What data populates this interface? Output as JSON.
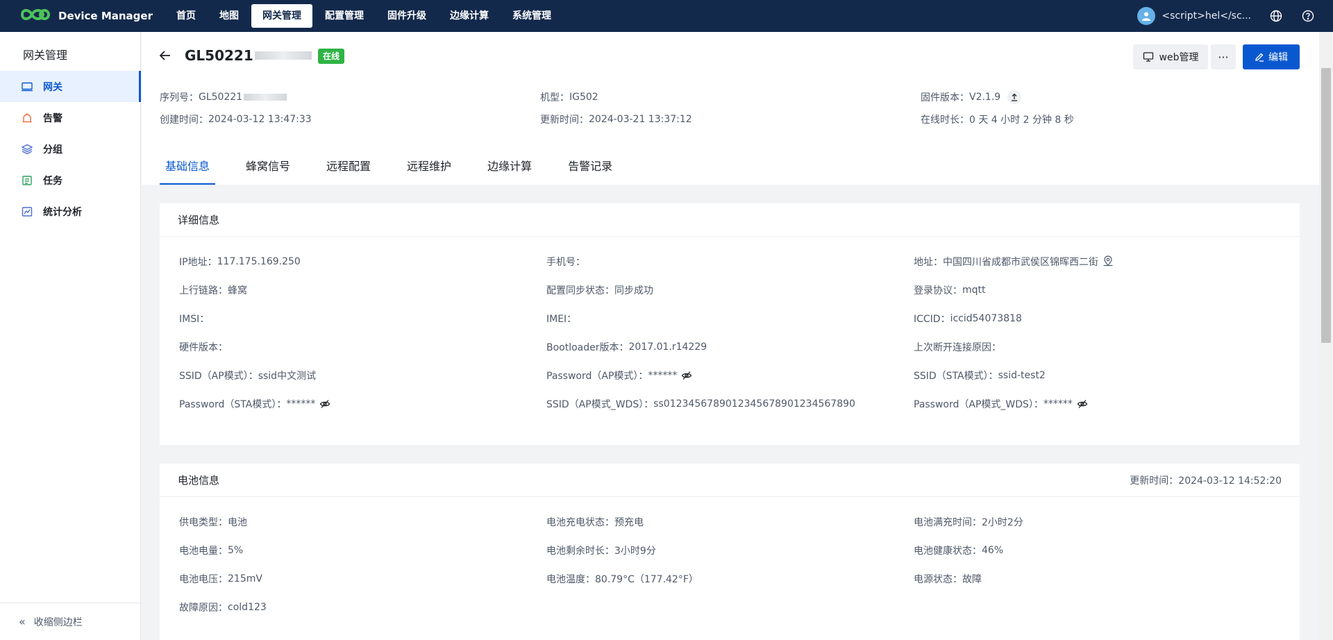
{
  "app": {
    "brand": "Device Manager"
  },
  "nav": [
    {
      "label": "首页",
      "active": false
    },
    {
      "label": "地图",
      "active": false
    },
    {
      "label": "网关管理",
      "active": true
    },
    {
      "label": "配置管理",
      "active": false
    },
    {
      "label": "固件升级",
      "active": false
    },
    {
      "label": "边缘计算",
      "active": false
    },
    {
      "label": "系统管理",
      "active": false
    }
  ],
  "user": {
    "name": "<script>hel</sc..."
  },
  "sidebar": {
    "title": "网关管理",
    "items": [
      {
        "label": "网关",
        "icon": "gateway-icon",
        "active": true
      },
      {
        "label": "告警",
        "icon": "alarm-icon",
        "active": false
      },
      {
        "label": "分组",
        "icon": "layers-icon",
        "active": false
      },
      {
        "label": "任务",
        "icon": "task-icon",
        "active": false
      },
      {
        "label": "统计分析",
        "icon": "stats-icon",
        "active": false
      }
    ],
    "collapse_label": "收缩侧边栏"
  },
  "device": {
    "title": "GL50221",
    "status": "在线",
    "status_color": "#2fb344",
    "serial_label": "序列号：",
    "serial": "GL50221",
    "model_label": "机型：",
    "model": "IG502",
    "firmware_label": "固件版本：",
    "firmware": "V2.1.9",
    "created_label": "创建时间：",
    "created": "2024-03-12 13:47:33",
    "updated_label": "更新时间：",
    "updated": "2024-03-21 13:37:12",
    "uptime_label": "在线时长：",
    "uptime": "0 天 4 小时 2 分钟 8 秒"
  },
  "actions": {
    "web": "web管理",
    "more": "···",
    "edit": "编辑"
  },
  "tabs": [
    {
      "label": "基础信息",
      "active": true
    },
    {
      "label": "蜂窝信号",
      "active": false
    },
    {
      "label": "远程配置",
      "active": false
    },
    {
      "label": "远程维护",
      "active": false
    },
    {
      "label": "边缘计算",
      "active": false
    },
    {
      "label": "告警记录",
      "active": false
    }
  ],
  "detail": {
    "title": "详细信息",
    "fields": [
      {
        "label": "IP地址：",
        "value": "117.175.169.250"
      },
      {
        "label": "手机号：",
        "value": ""
      },
      {
        "label": "地址：",
        "value": "中国四川省成都市武侯区锦晖西二街"
      },
      {
        "label": "上行链路：",
        "value": "蜂窝"
      },
      {
        "label": "配置同步状态：",
        "value": "同步成功"
      },
      {
        "label": "登录协议：",
        "value": "mqtt"
      },
      {
        "label": "IMSI：",
        "value": ""
      },
      {
        "label": "IMEI：",
        "value": ""
      },
      {
        "label": "ICCID：",
        "value": "iccid54073818"
      },
      {
        "label": "硬件版本：",
        "value": ""
      },
      {
        "label": "Bootloader版本：",
        "value": "2017.01.r14229"
      },
      {
        "label": "上次断开连接原因：",
        "value": ""
      },
      {
        "label": "SSID（AP模式）：",
        "value": "ssid中文测试"
      },
      {
        "label": "Password（AP模式）：",
        "value": "******"
      },
      {
        "label": "SSID（STA模式）：",
        "value": "ssid-test2"
      },
      {
        "label": "Password（STA模式）：",
        "value": "******"
      },
      {
        "label": "SSID（AP模式_WDS）：",
        "value": "ss0123456789012345678901234567890"
      },
      {
        "label": "Password（AP模式_WDS）：",
        "value": "******"
      }
    ]
  },
  "battery": {
    "title": "电池信息",
    "updated_label": "更新时间：",
    "updated": "2024-03-12 14:52:20",
    "fields": [
      {
        "label": "供电类型：",
        "value": "电池"
      },
      {
        "label": "电池充电状态：",
        "value": "预充电"
      },
      {
        "label": "电池满充时间：",
        "value": "2小时2分"
      },
      {
        "label": "电池电量：",
        "value": "5%"
      },
      {
        "label": "电池剩余时长：",
        "value": "3小时9分"
      },
      {
        "label": "电池健康状态：",
        "value": "46%"
      },
      {
        "label": "电池电压：",
        "value": "215mV"
      },
      {
        "label": "电池温度：",
        "value": "80.79°C（177.42°F）"
      },
      {
        "label": "电源状态：",
        "value": "故障"
      },
      {
        "label": "故障原因：",
        "value": "cold123"
      }
    ]
  }
}
